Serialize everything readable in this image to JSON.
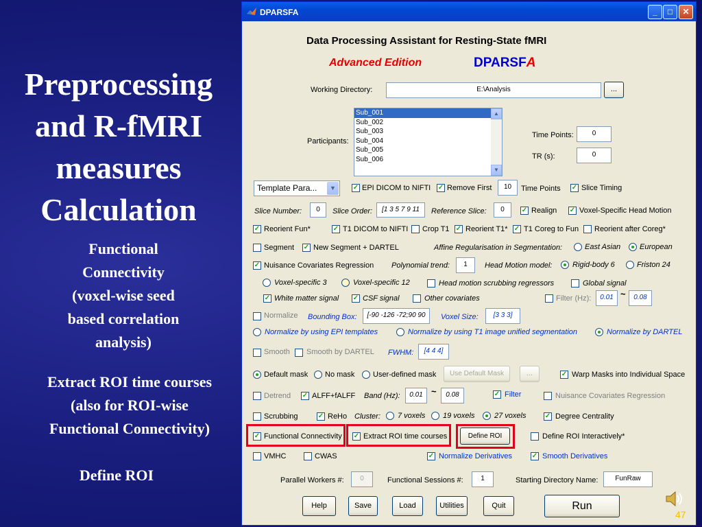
{
  "slide": {
    "title_lines": [
      "Preprocessing",
      "and R-fMRI",
      "measures",
      "Calculation"
    ],
    "subtitle_lines": [
      "Functional",
      "Connectivity",
      "(voxel-wise seed",
      "based correlation",
      "analysis)"
    ],
    "extract_lines": [
      "Extract ROI time courses",
      "(also for ROI-wise",
      "Functional Connectivity)"
    ],
    "define_roi": "Define ROI",
    "page_number": "47"
  },
  "window": {
    "title": "DPARSFA",
    "minimize": "_",
    "maximize": "□",
    "close": "✕"
  },
  "header": {
    "title": "Data Processing Assistant for Resting-State fMRI",
    "edition": "Advanced Edition",
    "brand_prefix": "DPARSF",
    "brand_suffix": "A",
    "brand_color": "#0000cc",
    "edition_color": "#e60000"
  },
  "working_dir": {
    "label": "Working Directory:",
    "value": "E:\\Analysis",
    "browse": "..."
  },
  "participants": {
    "label": "Participants:",
    "items": [
      "Sub_001",
      "Sub_002",
      "Sub_003",
      "Sub_004",
      "Sub_005",
      "Sub_006"
    ],
    "selected_index": 0
  },
  "time_points": {
    "label": "Time Points:",
    "value": "0"
  },
  "tr": {
    "label": "TR (s):",
    "value": "0"
  },
  "template": {
    "value": "Template Para..."
  },
  "row1": {
    "epi_dicom": "EPI DICOM to NIFTI",
    "remove_first": "Remove First",
    "remove_first_value": "10",
    "time_points": "Time Points",
    "slice_timing": "Slice Timing"
  },
  "row2": {
    "slice_number": "Slice Number:",
    "slice_number_value": "0",
    "slice_order": "Slice Order:",
    "slice_order_value": "[1 3 5 7 9 11",
    "reference_slice": "Reference Slice:",
    "reference_slice_value": "0",
    "realign": "Realign",
    "voxel_specific_head_motion": "Voxel-Specific Head Motion"
  },
  "row3": {
    "reorient_fun": "Reorient Fun*",
    "t1_dicom": "T1 DICOM to NIFTI",
    "crop_t1": "Crop T1",
    "reorient_t1": "Reorient T1*",
    "t1_coreg": "T1 Coreg to Fun",
    "reorient_after_coreg": "Reorient after Coreg*"
  },
  "row4": {
    "segment": "Segment",
    "new_segment": "New Segment + DARTEL",
    "affine_reg": "Affine Regularisation in Segmentation:",
    "east_asian": "East Asian",
    "european": "European"
  },
  "row5": {
    "nuisance": "Nuisance Covariates Regression",
    "polynomial_trend": "Polynomial trend:",
    "polynomial_value": "1",
    "head_motion_model": "Head Motion model:",
    "rigid_body_6": "Rigid-body 6",
    "friston_24": "Friston 24"
  },
  "row6": {
    "voxel_specific_3": "Voxel-specific 3",
    "voxel_specific_12": "Voxel-specific 12",
    "head_motion_scrubbing": "Head motion scrubbing regressors",
    "global_signal": "Global signal"
  },
  "row7": {
    "white_matter": "White matter signal",
    "csf_signal": "CSF signal",
    "other_covariates": "Other covariates",
    "filter_hz": "Filter (Hz):",
    "filter_low": "0.01",
    "tilde": "~",
    "filter_high": "0.08"
  },
  "row8": {
    "normalize": "Normalize",
    "bounding_box": "Bounding Box:",
    "bounding_box_value": "[-90 -126 -72;90 90",
    "voxel_size": "Voxel Size:",
    "voxel_size_value": "[3 3 3]"
  },
  "row9": {
    "norm_epi": "Normalize by using EPI templates",
    "norm_t1": "Normalize by using T1 image unified segmentation",
    "norm_dartel": "Normalize by DARTEL"
  },
  "row10": {
    "smooth": "Smooth",
    "smooth_dartel": "Smooth by DARTEL",
    "fwhm": "FWHM:",
    "fwhm_value": "[4 4 4]"
  },
  "row11": {
    "default_mask": "Default mask",
    "no_mask": "No mask",
    "user_defined_mask": "User-defined mask",
    "use_default_mask": "Use Default Mask",
    "mask_browse": "...",
    "warp_masks": "Warp Masks into Individual Space"
  },
  "row12": {
    "detrend": "Detrend",
    "alff": "ALFF+fALFF",
    "band_hz": "Band (Hz):",
    "band_low": "0.01",
    "tilde": "~",
    "band_high": "0.08",
    "filter": "Filter",
    "nuisance_cov_reg": "Nuisance Covariates Regression"
  },
  "row13": {
    "scrubbing": "Scrubbing",
    "reho": "ReHo",
    "cluster": "Cluster:",
    "voxels_7": "7 voxels",
    "voxels_19": "19 voxels",
    "voxels_27": "27 voxels",
    "degree_centrality": "Degree Centrality"
  },
  "row14": {
    "functional_connectivity": "Functional Connectivity",
    "extract_roi": "Extract ROI time courses",
    "define_roi_button": "Define ROI",
    "define_roi_interactively": "Define ROI Interactively*",
    "highlight_color": "#e0001b"
  },
  "row15": {
    "vmhc": "VMHC",
    "cwas": "CWAS",
    "normalize_derivatives": "Normalize Derivatives",
    "smooth_derivatives": "Smooth Derivatives"
  },
  "row16": {
    "parallel_workers": "Parallel Workers #:",
    "parallel_workers_value": "0",
    "functional_sessions": "Functional Sessions #:",
    "functional_sessions_value": "1",
    "starting_dir": "Starting Directory Name:",
    "starting_dir_value": "FunRaw"
  },
  "bottom_buttons": {
    "help": "Help",
    "save": "Save",
    "load": "Load",
    "utilities": "Utilities",
    "quit": "Quit",
    "run": "Run"
  },
  "check_glyph": "✓"
}
